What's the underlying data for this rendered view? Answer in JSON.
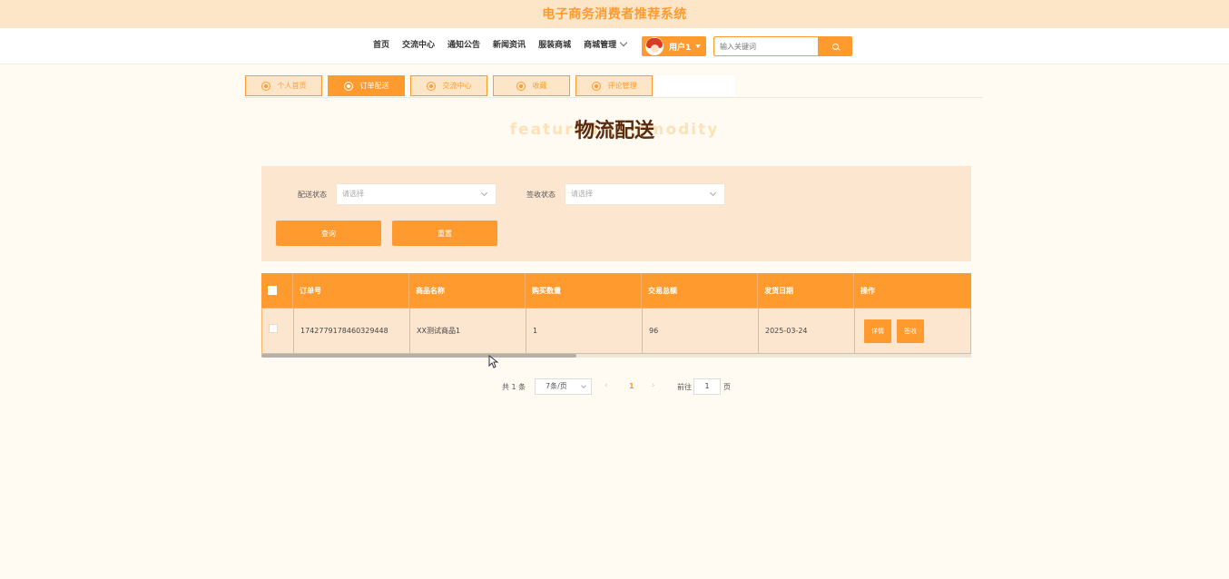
{
  "app": {
    "title": "电子商务消费者推荐系统"
  },
  "nav": {
    "items": [
      "首页",
      "交流中心",
      "通知公告",
      "新闻资讯",
      "服装商城",
      "商城管理"
    ],
    "user_label": "用户1",
    "search_placeholder": "输入关键词"
  },
  "tabs": [
    {
      "label": "个人首页",
      "active": false
    },
    {
      "label": "订单配送",
      "active": true
    },
    {
      "label": "交流中心",
      "active": false
    },
    {
      "label": "收藏",
      "active": false
    },
    {
      "label": "评论管理",
      "active": false
    }
  ],
  "page": {
    "heading": "物流配送",
    "heading_bg": "featured commodity"
  },
  "filters": {
    "delivery_label": "配送状态",
    "delivery_placeholder": "请选择",
    "signed_label": "签收状态",
    "signed_placeholder": "请选择",
    "query_button": "查询",
    "reset_button": "重置"
  },
  "table": {
    "columns": [
      "订单号",
      "商品名称",
      "购买数量",
      "交易总额",
      "发货日期",
      "操作"
    ],
    "rows": [
      {
        "order_no": "1742779178460329448",
        "product": "XX测试商品1",
        "qty": "1",
        "total": "96",
        "ship_date": "2025-03-24",
        "actions": [
          "详情",
          "签收"
        ]
      }
    ]
  },
  "pagination": {
    "total": "共 1 条",
    "page_size": "7条/页",
    "current": "1",
    "goto_label": "前往",
    "goto_value": "1",
    "page_suffix": "页"
  },
  "colors": {
    "accent": "#ff9a2e",
    "panel": "#fde6cf",
    "header_bg": "#fde6c7"
  }
}
